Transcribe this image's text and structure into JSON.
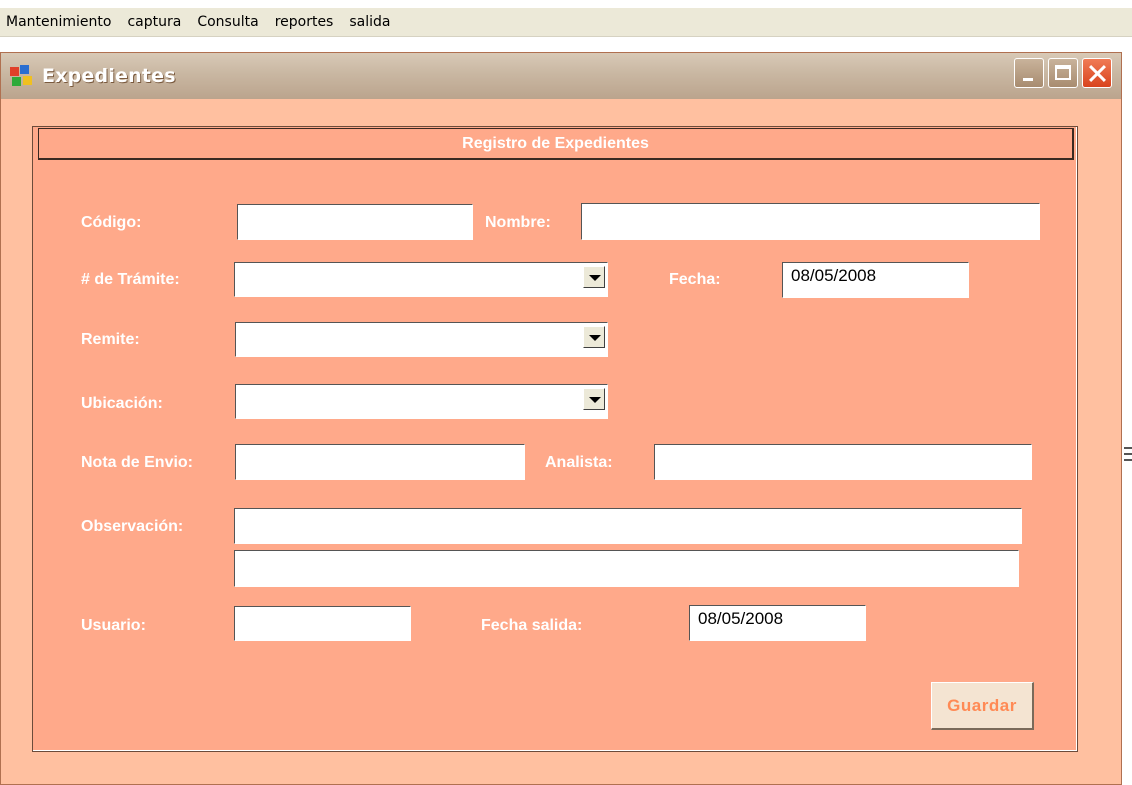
{
  "menubar": {
    "items": [
      "Mantenimiento",
      "captura",
      "Consulta",
      "reportes",
      "salida"
    ]
  },
  "window": {
    "title": "Expedientes",
    "app_icon": "app-window-icon",
    "controls": [
      "minimize-icon",
      "maximize-icon",
      "close-icon"
    ]
  },
  "form": {
    "header": "Registro de Expedientes",
    "codigo": {
      "label": "Código:",
      "value": ""
    },
    "nombre": {
      "label": "Nombre:",
      "value": ""
    },
    "tramite": {
      "label": "# de Trámite:",
      "value": ""
    },
    "fecha": {
      "label": "Fecha:",
      "value": "08/05/2008"
    },
    "remite": {
      "label": "Remite:",
      "value": ""
    },
    "ubicacion": {
      "label": "Ubicación:",
      "value": ""
    },
    "nota_envio": {
      "label": "Nota de Envio:",
      "value": ""
    },
    "analista": {
      "label": "Analista:",
      "value": ""
    },
    "observacion": {
      "label": "Observación:",
      "line1": "",
      "line2": ""
    },
    "usuario": {
      "label": "Usuario:",
      "value": ""
    },
    "fecha_salida": {
      "label": "Fecha salida:",
      "value": "08/05/2008"
    },
    "guardar_label": "Guardar"
  },
  "colors": {
    "window_bg": "#ffc0a0",
    "panel_bg": "#ffa98a",
    "label_text": "#ffffff",
    "button_text": "#ff8a55",
    "close_button": "#e0522b"
  }
}
